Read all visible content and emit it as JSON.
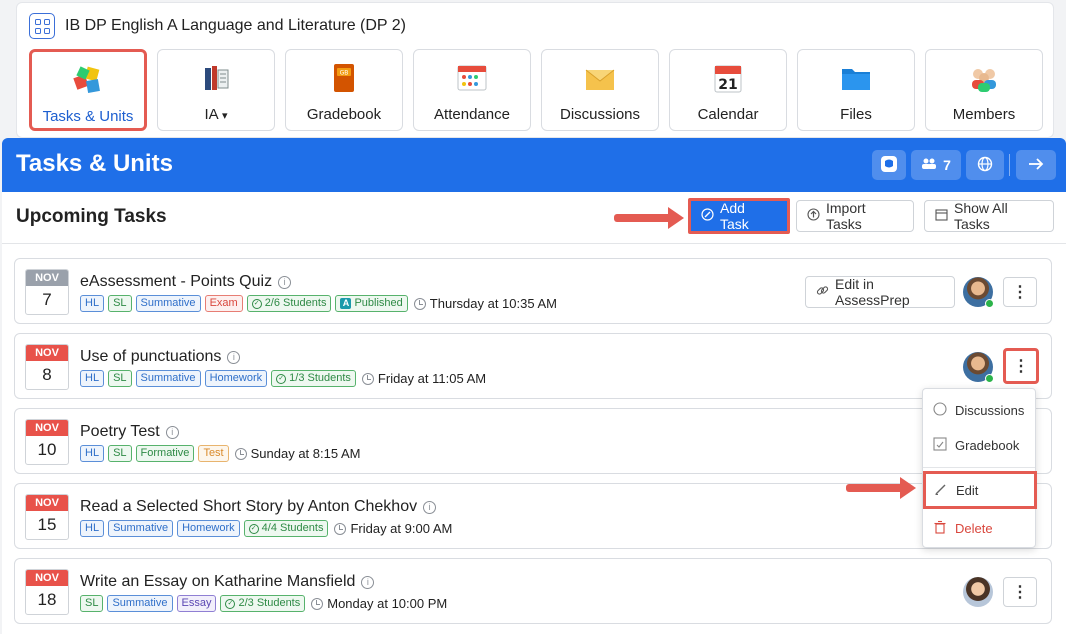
{
  "course": {
    "title": "IB DP English A Language and Literature (DP 2)"
  },
  "tools": [
    {
      "label": "Tasks & Units",
      "icon": "puzzle-icon"
    },
    {
      "label": "IA",
      "caret": "▾",
      "icon": "books-icon"
    },
    {
      "label": "Gradebook",
      "icon": "gradebook-icon"
    },
    {
      "label": "Attendance",
      "icon": "attendance-icon"
    },
    {
      "label": "Discussions",
      "icon": "envelope-icon"
    },
    {
      "label": "Calendar",
      "icon": "calendar-icon"
    },
    {
      "label": "Files",
      "icon": "folder-icon"
    },
    {
      "label": "Members",
      "icon": "members-icon"
    }
  ],
  "header": {
    "title": "Tasks & Units",
    "member_count": "7"
  },
  "panel": {
    "title": "Upcoming Tasks",
    "add_task": "Add Task",
    "import_tasks": "Import Tasks",
    "show_all": "Show All Tasks"
  },
  "tasks": [
    {
      "month": "NOV",
      "day": "7",
      "name": "eAssessment - Points Quiz",
      "tags": [
        "HL",
        "SL",
        "Summative",
        "Exam",
        "2/6 Students",
        "Published"
      ],
      "due": "Thursday at 10:35 AM",
      "action": "Edit in AssessPrep"
    },
    {
      "month": "NOV",
      "day": "8",
      "name": "Use of punctuations",
      "tags": [
        "HL",
        "SL",
        "Summative",
        "Homework",
        "1/3 Students"
      ],
      "due": "Friday at 11:05 AM"
    },
    {
      "month": "NOV",
      "day": "10",
      "name": "Poetry Test",
      "tags": [
        "HL",
        "SL",
        "Formative",
        "Test"
      ],
      "due": "Sunday at 8:15 AM"
    },
    {
      "month": "NOV",
      "day": "15",
      "name": "Read a Selected Short Story by Anton Chekhov",
      "tags": [
        "HL",
        "Summative",
        "Homework",
        "4/4 Students"
      ],
      "due": "Friday at 9:00 AM"
    },
    {
      "month": "NOV",
      "day": "18",
      "name": "Write an Essay on Katharine Mansfield",
      "tags": [
        "SL",
        "Summative",
        "Essay",
        "2/3 Students"
      ],
      "due": "Monday at 10:00 PM"
    }
  ],
  "menu": {
    "discussions": "Discussions",
    "gradebook": "Gradebook",
    "edit": "Edit",
    "delete": "Delete"
  },
  "colors": {
    "brand_blue": "#1f6fe8",
    "highlight_red": "#e45b52",
    "month_gray": "#9aa1ab",
    "month_red": "#e8524a"
  }
}
